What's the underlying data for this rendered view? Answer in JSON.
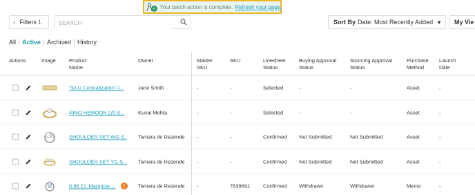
{
  "banner": {
    "message": "Your batch action is complete.",
    "refresh_link": "Refresh your page."
  },
  "toolbar": {
    "filters_label": "Filters",
    "filters_count": "1",
    "search_placeholder": "SEARCH",
    "sort_prefix": "Sort By",
    "sort_value": "Date: Most Recently Added",
    "views_label": "My Vie"
  },
  "tabs": [
    "All",
    "Active",
    "Archived",
    "History"
  ],
  "active_tab": "Active",
  "columns": {
    "actions": "Actions",
    "image": "Image",
    "product_name": "Product Name",
    "owner": "Owner",
    "master_sku": "Master SKU",
    "sku": "SKU",
    "linesheet_status": "Linesheet Status",
    "buying_approval_status": "Buying Approval Status",
    "sourcing_approval_status": "Sourcing Approval Status",
    "purchase_method": "Purchase Method",
    "launch_date": "Launch Date"
  },
  "rows": [
    {
      "product": "\"SKU Centralization\"-l...",
      "owner": "Jane Smith",
      "master_sku": "-",
      "sku": "-",
      "linesheet": "Selected",
      "buying": "-",
      "sourcing": "-",
      "purchase": "Asset",
      "launch": "-",
      "image_icon": "bracelet-icon"
    },
    {
      "product": "RING HEMOON 2/0.S...",
      "owner": "Kunal Mehta",
      "master_sku": "-",
      "sku": "-",
      "linesheet": "Selected",
      "buying": "-",
      "sourcing": "-",
      "purchase": "Asset",
      "launch": "-",
      "image_icon": "ring-icon"
    },
    {
      "product": "SHOULDER SET WG S...",
      "owner": "Tamara de Rezende",
      "master_sku": "-",
      "sku": "-",
      "linesheet": "Confirmed",
      "buying": "Not Submitted",
      "sourcing": "Not Submitted",
      "purchase": "Asset",
      "launch": "-",
      "image_icon": "diamond-ring-icon"
    },
    {
      "product": "SHOULDER SET YG S...",
      "owner": "Tamara de Rezende",
      "master_sku": "-",
      "sku": "-",
      "linesheet": "Confirmed",
      "buying": "Not Submitted",
      "sourcing": "Not Submitted",
      "purchase": "Asset",
      "launch": "-",
      "image_icon": "gold-ring-icon"
    },
    {
      "product": "0.96 Ct. Marquise ...",
      "owner": "Tamara de Rezende",
      "master_sku": "-",
      "sku": "7639691",
      "linesheet": "Confirmed",
      "buying": "Withdrawn",
      "sourcing": "Withdrawn",
      "purchase": "Memo",
      "launch": "-",
      "image_icon": "marquise-ring-icon",
      "warning": "!"
    }
  ],
  "colors": {
    "accent": "#1fa0a8",
    "link": "#1a9ab8",
    "banner_bg": "#e9f6ef",
    "banner_border": "#f0b429",
    "success": "#2e9e6b",
    "warning": "#f07a1a"
  }
}
